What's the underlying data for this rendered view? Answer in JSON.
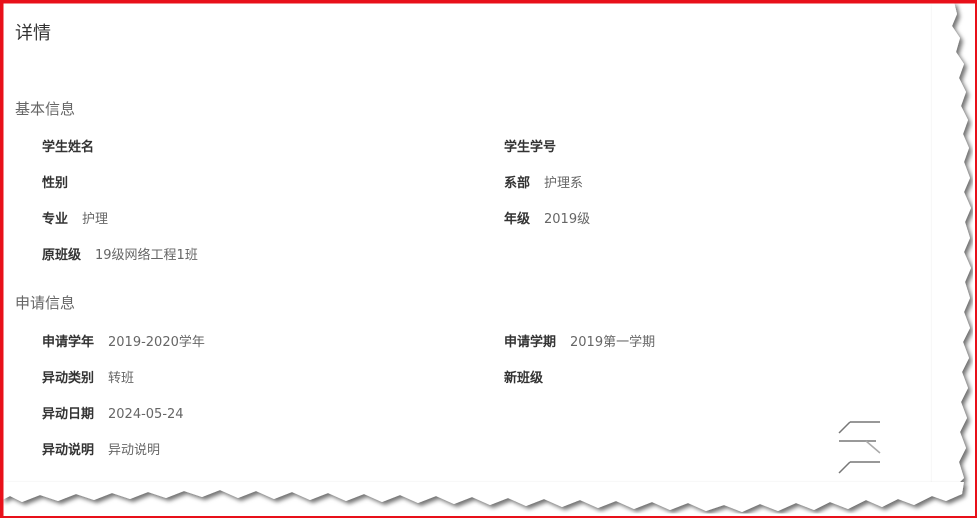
{
  "page": {
    "title": "详情"
  },
  "basic_info": {
    "title": "基本信息",
    "fields": {
      "student_name": {
        "label": "学生姓名",
        "value": ""
      },
      "student_id": {
        "label": "学生学号",
        "value": ""
      },
      "gender": {
        "label": "性别",
        "value": ""
      },
      "department": {
        "label": "系部",
        "value": "护理系"
      },
      "major": {
        "label": "专业",
        "value": "护理"
      },
      "grade": {
        "label": "年级",
        "value": "2019级"
      },
      "original_class": {
        "label": "原班级",
        "value": "19级网络工程1班"
      }
    }
  },
  "application_info": {
    "title": "申请信息",
    "fields": {
      "academic_year": {
        "label": "申请学年",
        "value": "2019-2020学年"
      },
      "semester": {
        "label": "申请学期",
        "value": "2019第一学期"
      },
      "change_type": {
        "label": "异动类别",
        "value": "转班"
      },
      "new_class": {
        "label": "新班级",
        "value": ""
      },
      "change_date": {
        "label": "异动日期",
        "value": "2024-05-24"
      },
      "change_note": {
        "label": "异动说明",
        "value": "异动说明"
      }
    }
  },
  "icons": {
    "corner_widget": "loading-lines-icon"
  },
  "colors": {
    "frame_border": "#e8101a",
    "label": "#333333",
    "value": "#666666"
  }
}
